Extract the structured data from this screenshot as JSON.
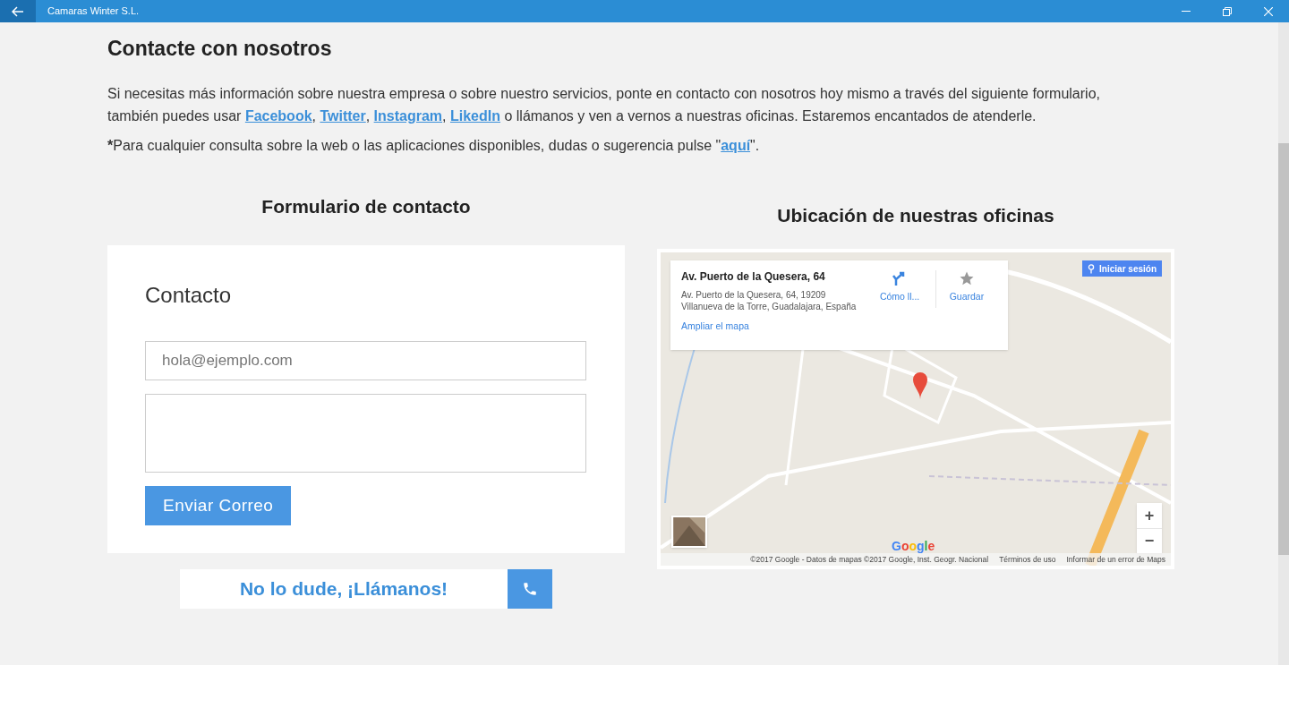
{
  "window": {
    "title": "Camaras Winter S.L."
  },
  "page": {
    "heading": "Contacte con nosotros",
    "intro": [
      {
        "kind": "text",
        "text": "Si necesitas más información sobre nuestra empresa o sobre nuestro servicios, ponte en contacto con nosotros hoy mismo a través del siguiente formulario, también puedes usar "
      },
      {
        "kind": "link",
        "text": "Facebook"
      },
      {
        "kind": "text",
        "text": ", "
      },
      {
        "kind": "link",
        "text": "Twitter"
      },
      {
        "kind": "text",
        "text": ", "
      },
      {
        "kind": "link",
        "text": "Instagram"
      },
      {
        "kind": "text",
        "text": ", "
      },
      {
        "kind": "link",
        "text": "LikedIn"
      },
      {
        "kind": "text",
        "text": " o llámanos y ven a vernos a nuestras oficinas. Estaremos encantados de atenderle."
      }
    ],
    "note": [
      {
        "kind": "bold",
        "text": "*"
      },
      {
        "kind": "text",
        "text": "Para cualquier consulta sobre la web o las aplicaciones disponibles, dudas o sugerencia pulse \""
      },
      {
        "kind": "link",
        "text": "aquí"
      },
      {
        "kind": "text",
        "text": "\"."
      }
    ]
  },
  "form": {
    "heading": "Formulario de contacto",
    "title": "Contacto",
    "email": {
      "placeholder": "hola@ejemplo.com"
    },
    "send_button": "Enviar Correo",
    "call_banner": "No lo dude, ¡Llámanos!"
  },
  "map": {
    "heading": "Ubicación de nuestras oficinas",
    "info_card": {
      "title": "Av. Puerto de la Quesera, 64",
      "address": "Av. Puerto de la Quesera, 64, 19209 Villanueva de la Torre, Guadalajara, España",
      "enlarge_link": "Ampliar el mapa",
      "directions": "Cómo ll...",
      "save": "Guardar"
    },
    "sign_in": "Iniciar sesión",
    "zoom_in": "+",
    "zoom_out": "−",
    "logo": "Google",
    "footer": [
      "©2017 Google - Datos de mapas ©2017 Google, Inst. Geogr. Nacional",
      "Términos de uso",
      "Informar de un error de Maps"
    ]
  }
}
